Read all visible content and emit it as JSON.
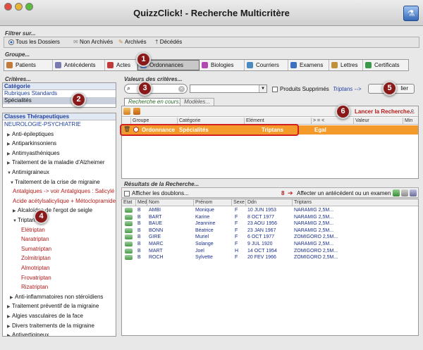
{
  "window": {
    "title": "QuizzClick! - Recherche Multicritère"
  },
  "filter": {
    "title": "Filtrer sur...",
    "options": [
      {
        "label": "Tous les Dossiers",
        "selected": true
      },
      {
        "label": "Non Archivés",
        "selected": false
      },
      {
        "label": "Archivés",
        "selected": false
      },
      {
        "label": "Décédés",
        "selected": false
      }
    ]
  },
  "groupe": {
    "title": "Groupe...",
    "tabs": [
      {
        "label": "Patients",
        "color": "#c47a3a"
      },
      {
        "label": "Antécédents",
        "color": "#7a7ab0"
      },
      {
        "label": "Actes",
        "color": "#c03a3a"
      },
      {
        "label": "Ordonnances",
        "color": "#5a8ad0"
      },
      {
        "label": "Biologies",
        "color": "#b04ab0"
      },
      {
        "label": "Courriers",
        "color": "#4a8ac0"
      },
      {
        "label": "Examens",
        "color": "#3a70c0"
      },
      {
        "label": "Lettres",
        "color": "#c0903a"
      },
      {
        "label": "Certificats",
        "color": "#3a9a4a"
      }
    ],
    "active_tab": "Ordonnances"
  },
  "criteres": {
    "title": "Critères...",
    "categorie_label": "Catégorie",
    "categories": [
      "Rubriques Standards",
      "Spécialités"
    ],
    "classes_label": "Classes Thérapeutiques",
    "tree": [
      {
        "label": "NEUROLOGIE-PSYCHIATRIE",
        "level": 0,
        "tri": "",
        "color": "blue"
      },
      {
        "label": "Anti-épileptiques",
        "level": 1,
        "tri": "▶",
        "color": "black"
      },
      {
        "label": "Antiparkinsoniens",
        "level": 1,
        "tri": "▶",
        "color": "black"
      },
      {
        "label": "Antimyasthéniques",
        "level": 1,
        "tri": "▶",
        "color": "black"
      },
      {
        "label": "Traitement de la maladie d'Alzheimer",
        "level": 1,
        "tri": "▶",
        "color": "black"
      },
      {
        "label": "Antimigraineux",
        "level": 1,
        "tri": "▼",
        "color": "black"
      },
      {
        "label": "Traitement de la crise de migraine",
        "level": 2,
        "tri": "▼",
        "color": "black"
      },
      {
        "label": "Antalgiques -> voir Antalgiques : Salicylé",
        "level": 3,
        "tri": "",
        "color": "red"
      },
      {
        "label": "Acide acétylsalicylique + Métoclopramide",
        "level": 3,
        "tri": "",
        "color": "red"
      },
      {
        "label": "Alcaloïdes de l'ergot de seigle",
        "level": 3,
        "tri": "▶",
        "color": "black"
      },
      {
        "label": "Triptans",
        "level": 3,
        "tri": "▼",
        "color": "black"
      },
      {
        "label": "Elétriptan",
        "level": 4,
        "tri": "",
        "color": "red"
      },
      {
        "label": "Naratriptan",
        "level": 4,
        "tri": "",
        "color": "red"
      },
      {
        "label": "Sumatriptan",
        "level": 4,
        "tri": "",
        "color": "red"
      },
      {
        "label": "Zolmitriptan",
        "level": 4,
        "tri": "",
        "color": "red"
      },
      {
        "label": "Almotriptan",
        "level": 4,
        "tri": "",
        "color": "red"
      },
      {
        "label": "Frovatriptan",
        "level": 4,
        "tri": "",
        "color": "red"
      },
      {
        "label": "Rizatriptan",
        "level": 4,
        "tri": "",
        "color": "red"
      },
      {
        "label": "Anti-inflammatoires non stéroïdiens",
        "level": 2,
        "tri": "▶",
        "color": "black"
      },
      {
        "label": "Traitement préventif de la migraine",
        "level": 1,
        "tri": "▶",
        "color": "black"
      },
      {
        "label": "Algies vasculaires de la face",
        "level": 1,
        "tri": "▶",
        "color": "black"
      },
      {
        "label": "Divers traitements de la migraine",
        "level": 1,
        "tri": "▶",
        "color": "black"
      },
      {
        "label": "Antivertigineux",
        "level": 1,
        "tri": "▶",
        "color": "black"
      }
    ]
  },
  "valeurs": {
    "title": "Valeurs des critères...",
    "checkbox_label": "Produits Supprimés",
    "triptans_link": "Triptans -->",
    "button_label": "lier",
    "tab_recherche": "Recherche en cours...",
    "tab_modeles": "Modèles...",
    "launch_label": "Lancer la Recherche...",
    "columns": [
      "Groupe",
      "Catégorie",
      "Elément",
      "> = <",
      "Valeur",
      "Min"
    ],
    "row": {
      "groupe": "Ordonnance",
      "categorie": "Spécialités",
      "element": "Triptans",
      "op": "Egal",
      "valeur": "",
      "min": ""
    }
  },
  "resultats": {
    "title": "Résultats de la Recherche...",
    "checkbox_label": "Afficher les doublons...",
    "count": "8",
    "action_label": "Affecter un antécédent ou un examen",
    "columns": [
      "Etat",
      "Med",
      "Nom",
      "Prénom",
      "Sexe",
      "Ddn",
      "Triptans"
    ],
    "rows": [
      {
        "med": "B",
        "nom": "AMBI",
        "prenom": "Monique",
        "sexe": "F",
        "ddn": "10 JUN 1953",
        "trip": "NARAMIG 2,5M..."
      },
      {
        "med": "B",
        "nom": "BART",
        "prenom": "Karine",
        "sexe": "F",
        "ddn": "8 OCT 1977",
        "trip": "NARAMIG 2,5M..."
      },
      {
        "med": "B",
        "nom": "BAUE",
        "prenom": "Jeannine",
        "sexe": "F",
        "ddn": "23 AOU 1956",
        "trip": "NARAMIG 2,5M..."
      },
      {
        "med": "B",
        "nom": "BONN",
        "prenom": "Béatrice",
        "sexe": "F",
        "ddn": "23 JAN 1967",
        "trip": "NARAMIG 2,5M..."
      },
      {
        "med": "B",
        "nom": "GIRE",
        "prenom": "Muriel",
        "sexe": "F",
        "ddn": "6 OCT 1977",
        "trip": "ZOMIGORO 2,5M..."
      },
      {
        "med": "B",
        "nom": "MARC",
        "prenom": "Solange",
        "sexe": "F",
        "ddn": "9 JUL 1920",
        "trip": "NARAMIG 2,5M..."
      },
      {
        "med": "B",
        "nom": "MART",
        "prenom": "Joel",
        "sexe": "H",
        "ddn": "14 OCT 1954",
        "trip": "ZOMIGORO 2,5M..."
      },
      {
        "med": "B",
        "nom": "ROCH",
        "prenom": "Sylvette",
        "sexe": "F",
        "ddn": "20 FEV 1966",
        "trip": "ZOMIGORO 2,5M..."
      }
    ]
  },
  "badges": [
    "1",
    "2",
    "3",
    "4",
    "5",
    "6"
  ],
  "colors": {
    "highlight_row": "#f39a2a",
    "badge": "#8a1a1a",
    "selected_blue": "#c9d8f0"
  }
}
